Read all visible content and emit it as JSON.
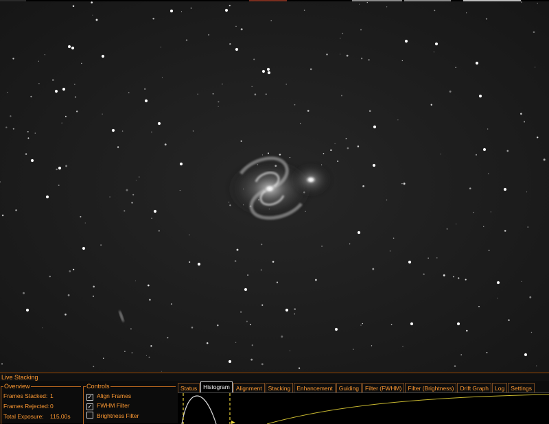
{
  "image": {
    "description_free": true,
    "background_color": "#000000",
    "star_color": "#ffffff"
  },
  "panel": {
    "title": "Live Stacking",
    "accent_color": "#ff9a32",
    "border_color": "#b4641e",
    "overview": {
      "title": "Overview",
      "rows": [
        {
          "label": "Frames Stacked:",
          "value": "1"
        },
        {
          "label": "Frames Rejected:",
          "value": "0"
        },
        {
          "label": "Total Exposure:",
          "value": "115,00s"
        }
      ]
    },
    "controls": {
      "title": "Controls",
      "items": [
        {
          "label": "Align Frames",
          "checked": true
        },
        {
          "label": "FWHM Filter",
          "checked": true
        },
        {
          "label": "Brightness Filter",
          "checked": false
        }
      ]
    },
    "tabs": [
      {
        "label": "Status",
        "active": false
      },
      {
        "label": "Histogram",
        "active": true
      },
      {
        "label": "Alignment",
        "active": false
      },
      {
        "label": "Stacking",
        "active": false
      },
      {
        "label": "Enhancement",
        "active": false
      },
      {
        "label": "Guiding",
        "active": false
      },
      {
        "label": "Filter (FWHM)",
        "active": false
      },
      {
        "label": "Filter (Brightness)",
        "active": false
      },
      {
        "label": "Drift Graph",
        "active": false
      },
      {
        "label": "Log",
        "active": false
      },
      {
        "label": "Settings",
        "active": false
      }
    ],
    "histogram": {
      "marker_color": "#e8d23a",
      "curve_color": "#d8d8d8",
      "tone_curve_color": "#c8b830"
    }
  }
}
